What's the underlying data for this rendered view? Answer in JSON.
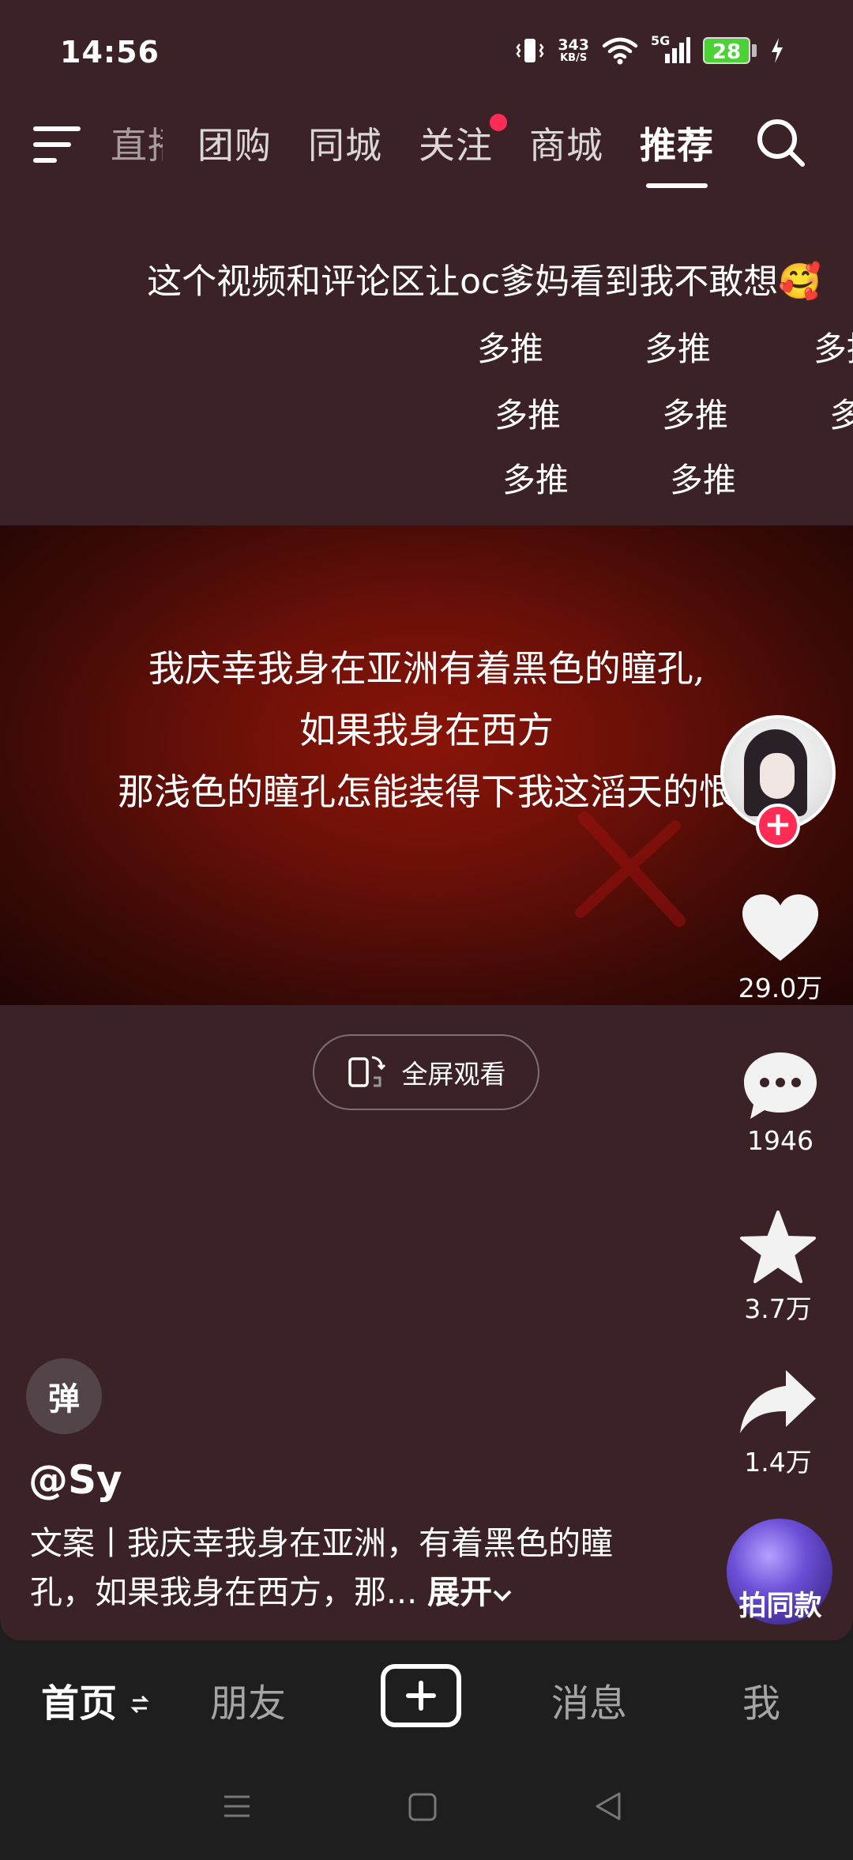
{
  "status_bar": {
    "time": "14:56",
    "net_speed": "343",
    "net_speed_unit": "KB/S",
    "network": "5G",
    "battery": "28",
    "battery_color": "#4cd137"
  },
  "top_nav": {
    "tabs": [
      {
        "label": "直播"
      },
      {
        "label": "团购"
      },
      {
        "label": "同城"
      },
      {
        "label": "关注"
      },
      {
        "label": "商城"
      },
      {
        "label": "推荐"
      }
    ],
    "active_tab": "推荐"
  },
  "caption": {
    "title": "这个视频和评论区让oc爹妈看到我不敢想🥰",
    "danmaku": [
      "多推",
      "多推",
      "多推",
      "多推",
      "多推",
      "多推",
      "多推",
      "多推"
    ]
  },
  "video": {
    "lines": [
      "我庆幸我身在亚洲有着黑色的瞳孔,",
      "如果我身在西方",
      "那浅色的瞳孔怎能装得下我这滔天的恨"
    ]
  },
  "fullscreen_button": {
    "label": "全屏观看"
  },
  "actions": {
    "likes": "29.0万",
    "comments": "1946",
    "favorites": "3.7万",
    "shares": "1.4万",
    "same_style": "拍同款"
  },
  "danmu_toggle": "弹",
  "author": {
    "username": "@Sy",
    "description": "文案丨我庆幸我身在亚洲，有着黑色的瞳孔，如果我身在西方，那...",
    "expand_label": "展开"
  },
  "bottom_nav": {
    "home": "首页",
    "friends": "朋友",
    "messages": "消息",
    "me": "我"
  },
  "colors": {
    "background": "#3a2226",
    "accent": "#fe2c55",
    "nav_bg": "#1e1e1e"
  }
}
